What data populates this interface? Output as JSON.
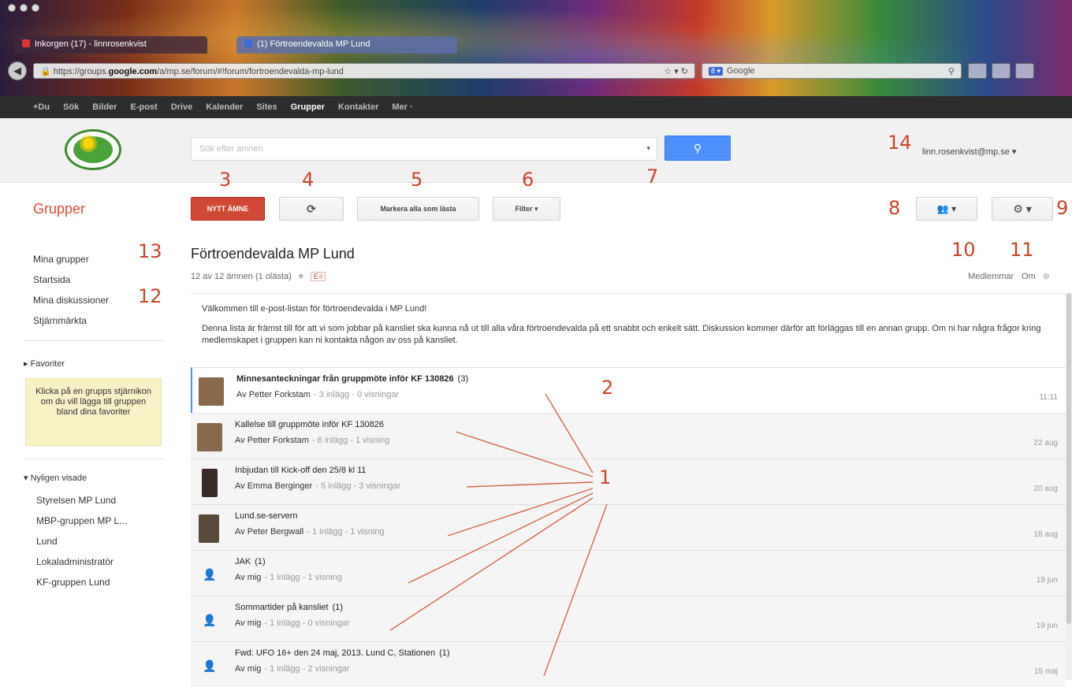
{
  "browser": {
    "tabs": [
      {
        "label": "Inkorgen (17) - linnrosenkvist"
      },
      {
        "label": "(1) Förtroendevalda MP Lund"
      }
    ],
    "url_prefix": "https://groups.",
    "url_host": "google.com",
    "url_path": "/a/mp.se/forum/#!forum/fortroendevalda-mp-lund",
    "search_placeholder": "Google",
    "search_engine_icon": "google-icon"
  },
  "gbar": {
    "items": [
      "+Du",
      "Sök",
      "Bilder",
      "E-post",
      "Drive",
      "Kalender",
      "Sites",
      "Grupper",
      "Kontakter",
      "Mer ·"
    ],
    "active": "Grupper"
  },
  "header": {
    "search_placeholder": "Sök efter ämnen",
    "search_icon": "search-icon",
    "account": "linn.rosenkvist@mp.se ▾"
  },
  "toolbar": {
    "section_title": "Grupper",
    "new_topic": "NYTT ÄMNE",
    "refresh_icon": "refresh-icon",
    "mark_all_read": "Markera alla som lästa",
    "filter": "Filter ▾",
    "members_icon": "people-icon",
    "settings_icon": "gear-icon"
  },
  "sidebar": {
    "nav": [
      "Mina grupper",
      "Startsida",
      "Mina diskussioner",
      "Stjärnmärkta"
    ],
    "favorites_header": "▸ Favoriter",
    "favorites_hint": "Klicka på en grupps stjärnikon om du vill lägga till gruppen bland dina favoriter",
    "recent_header": "▾ Nyligen visade",
    "recent": [
      "Styrelsen MP Lund",
      "MBP-gruppen MP L...",
      "Lund",
      "Lokaladministratör",
      "KF-gruppen Lund"
    ]
  },
  "group": {
    "title": "Förtroendevalda MP Lund",
    "subtitle": "12 av 12 ämnen (1 olästa)",
    "badge": "E-l",
    "links": {
      "members": "Medlemmar",
      "about": "Om"
    },
    "welcome_1": "Välkommen till e-post-listan för förtroendevalda i MP Lund!",
    "welcome_2": "Denna lista är främst till för att vi som jobbar på kansliet ska kunna nå ut till alla våra förtroendevalda på ett snabbt och enkelt sätt. Diskussion kommer därför att förläggas till en annan grupp. Om ni har några frågor kring medlemskapet i gruppen kan ni kontakta någon av oss på kansliet."
  },
  "threads": [
    {
      "title": "Minnesanteckningar från gruppmöte inför KF 130826",
      "count": "(3)",
      "by": "Av Petter Forkstam",
      "stats": "- 3 inlägg - 0 visningar",
      "date": "11:11",
      "avatar": "photo-1"
    },
    {
      "title": "Kallelse till gruppmöte inför KF 130826",
      "count": "",
      "by": "Av Petter Forkstam",
      "stats": "- 6 inlägg - 1 visning",
      "date": "22 aug",
      "avatar": "photo-1"
    },
    {
      "title": "Inbjudan till Kick-off den 25/8 kl 11",
      "count": "",
      "by": "Av Emma Berginger",
      "stats": "- 5 inlägg - 3 visningar",
      "date": "20 aug",
      "avatar": "photo-2"
    },
    {
      "title": "Lund.se-servern",
      "count": "",
      "by": "Av Peter Bergwall",
      "stats": "- 1 inlägg - 1 visning",
      "date": "18 aug",
      "avatar": "photo-3"
    },
    {
      "title": "JAK",
      "count": "(1)",
      "by": "Av mig",
      "stats": "- 1 inlägg - 1 visning",
      "date": "19 jun",
      "avatar": "person-icon"
    },
    {
      "title": "Sommartider på kansliet",
      "count": "(1)",
      "by": "Av mig",
      "stats": "- 1 inlägg - 0 visningar",
      "date": "19 jun",
      "avatar": "person-icon"
    },
    {
      "title": "Fwd: UFO 16+ den 24 maj, 2013. Lund C, Stationen",
      "count": "(1)",
      "by": "Av mig",
      "stats": "- 1 inlägg - 2 visningar",
      "date": "15 maj",
      "avatar": "person-icon"
    }
  ],
  "callouts": {
    "c1": "1",
    "c2": "2",
    "c3": "3",
    "c4": "4",
    "c5": "5",
    "c6": "6",
    "c7": "7",
    "c8": "8",
    "c9": "9",
    "c10": "10",
    "c11": "11",
    "c12": "12",
    "c13": "13",
    "c14": "14"
  },
  "colors": {
    "accent_red": "#dd4b39",
    "new_topic_red": "#d14836",
    "search_blue": "#4d90fe",
    "callout": "#c7442a"
  }
}
